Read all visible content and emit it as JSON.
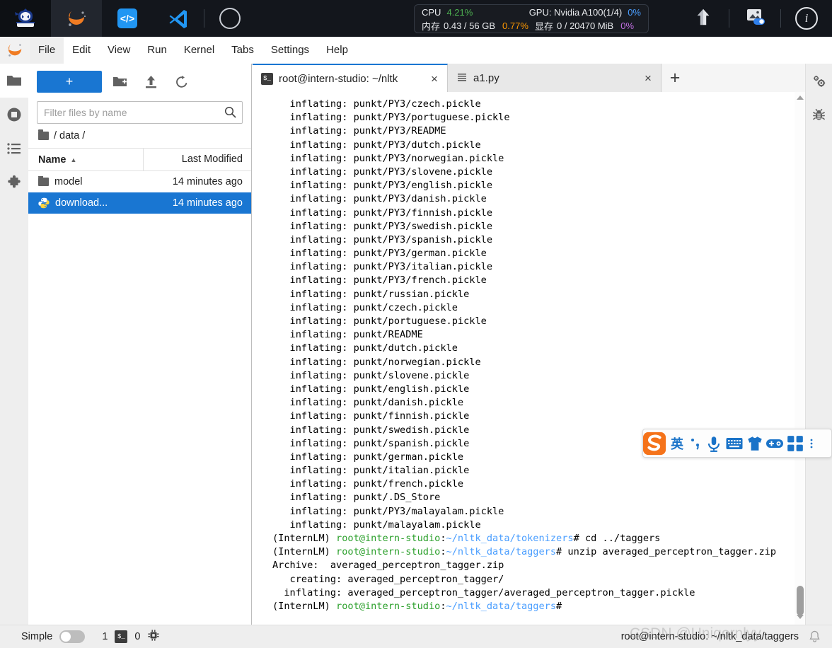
{
  "topbar": {
    "apps": [
      {
        "name": "intern-studio-logo",
        "icon": "robot-icon"
      },
      {
        "name": "jupyterlab-app",
        "icon": "jupyter-icon"
      },
      {
        "name": "code-server-app",
        "icon": "code-brackets-icon"
      },
      {
        "name": "vscode-app",
        "icon": "vscode-icon"
      },
      {
        "name": "compass-app",
        "icon": "compass-icon"
      }
    ],
    "stats": {
      "cpu_label": "CPU",
      "cpu_value": "4.21%",
      "mem_label": "内存",
      "mem_value": "0.43 / 56 GB",
      "mem_percent": "0.77%",
      "gpu_label": "GPU: Nvidia A100(1/4)",
      "gpu_percent": "0%",
      "vram_label": "显存",
      "vram_value": "0 / 20470 MiB",
      "vram_percent": "0%"
    },
    "right_icons": [
      {
        "name": "upload-arrow-icon"
      },
      {
        "name": "image-toggle-icon"
      },
      {
        "name": "info-icon",
        "glyph": "i"
      }
    ]
  },
  "menubar": {
    "items": [
      "File",
      "Edit",
      "View",
      "Run",
      "Kernel",
      "Tabs",
      "Settings",
      "Help"
    ]
  },
  "left_rail": [
    {
      "name": "sidebar-item-file-browser",
      "icon": "folder-icon",
      "active": true
    },
    {
      "name": "sidebar-item-running",
      "icon": "stop-square-icon",
      "active": false
    },
    {
      "name": "sidebar-item-toc",
      "icon": "list-icon",
      "active": false
    },
    {
      "name": "sidebar-item-extensions",
      "icon": "puzzle-icon",
      "active": false
    }
  ],
  "right_rail": [
    {
      "name": "sidebar-item-property-inspector",
      "icon": "gears-icon"
    },
    {
      "name": "sidebar-item-debugger",
      "icon": "bug-icon"
    }
  ],
  "browser": {
    "new_button": "+",
    "new_folder_title": "New Folder",
    "upload_title": "Upload Files",
    "refresh_title": "Refresh File List",
    "filter_placeholder": "Filter files by name",
    "breadcrumb": "/ data /",
    "columns": {
      "name": "Name",
      "modified": "Last Modified"
    },
    "rows": [
      {
        "name": "model",
        "modified": "14 minutes ago",
        "type": "folder",
        "selected": false
      },
      {
        "name": "download...",
        "modified": "14 minutes ago",
        "type": "python",
        "selected": true
      }
    ]
  },
  "tabs": [
    {
      "label": "root@intern-studio: ~/nltk",
      "icon": "terminal-icon",
      "active": true,
      "close": "×"
    },
    {
      "label": "a1.py",
      "icon": "file-lines-icon",
      "active": false,
      "close": "×"
    }
  ],
  "tab_add": "+",
  "terminal": {
    "lines": [
      {
        "segments": [
          {
            "t": "   inflating: punkt/PY3/czech.pickle",
            "c": "black"
          }
        ]
      },
      {
        "segments": [
          {
            "t": "   inflating: punkt/PY3/portuguese.pickle",
            "c": "black"
          }
        ]
      },
      {
        "segments": [
          {
            "t": "   inflating: punkt/PY3/README",
            "c": "black"
          }
        ]
      },
      {
        "segments": [
          {
            "t": "   inflating: punkt/PY3/dutch.pickle",
            "c": "black"
          }
        ]
      },
      {
        "segments": [
          {
            "t": "   inflating: punkt/PY3/norwegian.pickle",
            "c": "black"
          }
        ]
      },
      {
        "segments": [
          {
            "t": "   inflating: punkt/PY3/slovene.pickle",
            "c": "black"
          }
        ]
      },
      {
        "segments": [
          {
            "t": "   inflating: punkt/PY3/english.pickle",
            "c": "black"
          }
        ]
      },
      {
        "segments": [
          {
            "t": "   inflating: punkt/PY3/danish.pickle",
            "c": "black"
          }
        ]
      },
      {
        "segments": [
          {
            "t": "   inflating: punkt/PY3/finnish.pickle",
            "c": "black"
          }
        ]
      },
      {
        "segments": [
          {
            "t": "   inflating: punkt/PY3/swedish.pickle",
            "c": "black"
          }
        ]
      },
      {
        "segments": [
          {
            "t": "   inflating: punkt/PY3/spanish.pickle",
            "c": "black"
          }
        ]
      },
      {
        "segments": [
          {
            "t": "   inflating: punkt/PY3/german.pickle",
            "c": "black"
          }
        ]
      },
      {
        "segments": [
          {
            "t": "   inflating: punkt/PY3/italian.pickle",
            "c": "black"
          }
        ]
      },
      {
        "segments": [
          {
            "t": "   inflating: punkt/PY3/french.pickle",
            "c": "black"
          }
        ]
      },
      {
        "segments": [
          {
            "t": "   inflating: punkt/russian.pickle",
            "c": "black"
          }
        ]
      },
      {
        "segments": [
          {
            "t": "   inflating: punkt/czech.pickle",
            "c": "black"
          }
        ]
      },
      {
        "segments": [
          {
            "t": "   inflating: punkt/portuguese.pickle",
            "c": "black"
          }
        ]
      },
      {
        "segments": [
          {
            "t": "   inflating: punkt/README",
            "c": "black"
          }
        ]
      },
      {
        "segments": [
          {
            "t": "   inflating: punkt/dutch.pickle",
            "c": "black"
          }
        ]
      },
      {
        "segments": [
          {
            "t": "   inflating: punkt/norwegian.pickle",
            "c": "black"
          }
        ]
      },
      {
        "segments": [
          {
            "t": "   inflating: punkt/slovene.pickle",
            "c": "black"
          }
        ]
      },
      {
        "segments": [
          {
            "t": "   inflating: punkt/english.pickle",
            "c": "black"
          }
        ]
      },
      {
        "segments": [
          {
            "t": "   inflating: punkt/danish.pickle",
            "c": "black"
          }
        ]
      },
      {
        "segments": [
          {
            "t": "   inflating: punkt/finnish.pickle",
            "c": "black"
          }
        ]
      },
      {
        "segments": [
          {
            "t": "   inflating: punkt/swedish.pickle",
            "c": "black"
          }
        ]
      },
      {
        "segments": [
          {
            "t": "   inflating: punkt/spanish.pickle",
            "c": "black"
          }
        ]
      },
      {
        "segments": [
          {
            "t": "   inflating: punkt/german.pickle",
            "c": "black"
          }
        ]
      },
      {
        "segments": [
          {
            "t": "   inflating: punkt/italian.pickle",
            "c": "black"
          }
        ]
      },
      {
        "segments": [
          {
            "t": "   inflating: punkt/french.pickle",
            "c": "black"
          }
        ]
      },
      {
        "segments": [
          {
            "t": "   inflating: punkt/.DS_Store",
            "c": "black"
          }
        ]
      },
      {
        "segments": [
          {
            "t": "   inflating: punkt/PY3/malayalam.pickle",
            "c": "black"
          }
        ]
      },
      {
        "segments": [
          {
            "t": "   inflating: punkt/malayalam.pickle",
            "c": "black"
          }
        ]
      },
      {
        "segments": [
          {
            "t": "(InternLM) ",
            "c": "black"
          },
          {
            "t": "root@intern-studio",
            "c": "green"
          },
          {
            "t": ":",
            "c": "black"
          },
          {
            "t": "~/nltk_data/tokenizers",
            "c": "blue"
          },
          {
            "t": "# cd ../taggers",
            "c": "black"
          }
        ]
      },
      {
        "segments": [
          {
            "t": "(InternLM) ",
            "c": "black"
          },
          {
            "t": "root@intern-studio",
            "c": "green"
          },
          {
            "t": ":",
            "c": "black"
          },
          {
            "t": "~/nltk_data/taggers",
            "c": "blue"
          },
          {
            "t": "# unzip averaged_perceptron_tagger.zip",
            "c": "black"
          }
        ]
      },
      {
        "segments": [
          {
            "t": "Archive:  averaged_perceptron_tagger.zip",
            "c": "black"
          }
        ]
      },
      {
        "segments": [
          {
            "t": "   creating: averaged_perceptron_tagger/",
            "c": "black"
          }
        ]
      },
      {
        "segments": [
          {
            "t": "  inflating: averaged_perceptron_tagger/averaged_perceptron_tagger.pickle",
            "c": "black"
          }
        ]
      },
      {
        "segments": [
          {
            "t": "(InternLM) ",
            "c": "black"
          },
          {
            "t": "root@intern-studio",
            "c": "green"
          },
          {
            "t": ":",
            "c": "black"
          },
          {
            "t": "~/nltk_data/taggers",
            "c": "blue"
          },
          {
            "t": "#",
            "c": "black"
          }
        ]
      }
    ]
  },
  "statusbar": {
    "mode_label": "Simple",
    "mode_on": false,
    "kernel_count": "1",
    "terminal_count": "0",
    "right_text": "root@intern-studio: ~/nltk_data/taggers"
  },
  "ime": {
    "name": "sogou-input-method",
    "lang_label": "英",
    "items": [
      {
        "name": "sogou-logo-icon"
      },
      {
        "name": "ime-language-toggle"
      },
      {
        "name": "ime-punctuation-icon"
      },
      {
        "name": "ime-voice-icon"
      },
      {
        "name": "ime-keyboard-icon"
      },
      {
        "name": "ime-skin-icon"
      },
      {
        "name": "ime-emoji-icon"
      },
      {
        "name": "ime-toolbox-icon"
      },
      {
        "name": "ime-more-icon"
      }
    ]
  },
  "watermark": "CSDN @Uniqornlyy",
  "colors": {
    "accent_blue": "#1976d2",
    "topbar_bg": "#13161c",
    "cpu_green": "#4caf50",
    "gpu_blue": "#4a9eff",
    "mem_orange": "#ff9800",
    "vram_purple": "#c06fe0",
    "prompt_green": "#2ca02c",
    "path_blue": "#4a9eff"
  }
}
